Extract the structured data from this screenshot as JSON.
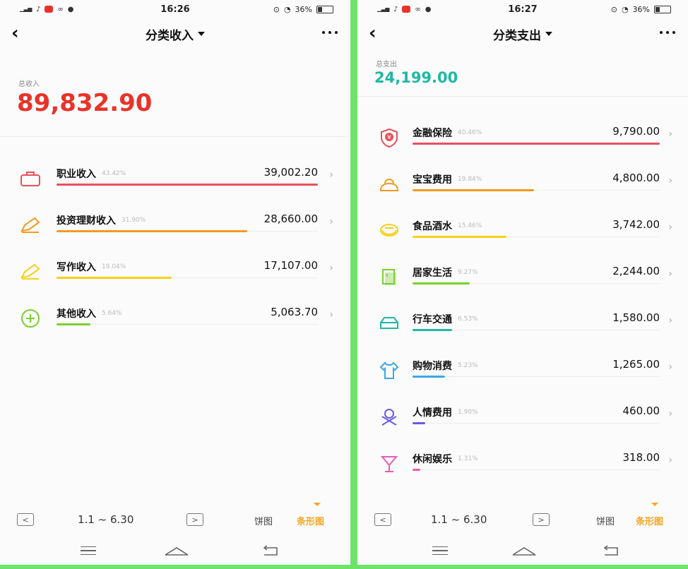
{
  "colors": {
    "income_total": "#e8332a",
    "expense_total": "#1db9a5",
    "active_view": "#f5a623",
    "frame": "#6ee36a"
  },
  "left": {
    "status": {
      "time": "16:26",
      "battery": "36%"
    },
    "title": "分类收入",
    "total_label": "总收入",
    "total_value": "89,832.90",
    "items": [
      {
        "name": "职业收入",
        "percent": "43.42%",
        "amount": "39,002.20",
        "icon": "briefcase-icon",
        "color": "#e8505a",
        "ratio": 1.0
      },
      {
        "name": "投资理财收入",
        "percent": "31.90%",
        "amount": "28,660.00",
        "icon": "pencil-icon",
        "color": "#f39a1e",
        "ratio": 0.73
      },
      {
        "name": "写作收入",
        "percent": "19.04%",
        "amount": "17,107.00",
        "icon": "pencil-icon",
        "color": "#f5d218",
        "ratio": 0.44
      },
      {
        "name": "其他收入",
        "percent": "5.64%",
        "amount": "5,063.70",
        "icon": "plus-circle-icon",
        "color": "#7ccf2e",
        "ratio": 0.13
      }
    ],
    "date_range": "1.1 ~ 6.30",
    "prev_label": "<",
    "next_label": ">",
    "view_pie": "饼图",
    "view_bar": "条形图"
  },
  "right": {
    "status": {
      "time": "16:27",
      "battery": "36%"
    },
    "title": "分类支出",
    "total_label": "总支出",
    "total_value": "24,199.00",
    "items": [
      {
        "name": "金融保险",
        "percent": "40.46%",
        "amount": "9,790.00",
        "icon": "shield-yen-icon",
        "color": "#e8505a",
        "ratio": 1.0
      },
      {
        "name": "宝宝费用",
        "percent": "19.84%",
        "amount": "4,800.00",
        "icon": "bag-icon",
        "color": "#f39a1e",
        "ratio": 0.49
      },
      {
        "name": "食品酒水",
        "percent": "15.46%",
        "amount": "3,742.00",
        "icon": "bowl-icon",
        "color": "#f5d218",
        "ratio": 0.38
      },
      {
        "name": "居家生活",
        "percent": "9.27%",
        "amount": "2,244.00",
        "icon": "book-icon",
        "color": "#7ccf2e",
        "ratio": 0.23
      },
      {
        "name": "行车交通",
        "percent": "6.53%",
        "amount": "1,580.00",
        "icon": "car-icon",
        "color": "#1db9a5",
        "ratio": 0.16
      },
      {
        "name": "购物消费",
        "percent": "5.23%",
        "amount": "1,265.00",
        "icon": "shirt-icon",
        "color": "#3aa8e8",
        "ratio": 0.13
      },
      {
        "name": "人情费用",
        "percent": "1.90%",
        "amount": "460.00",
        "icon": "person-icon",
        "color": "#6a5ae8",
        "ratio": 0.05
      },
      {
        "name": "休闲娱乐",
        "percent": "1.31%",
        "amount": "318.00",
        "icon": "cocktail-icon",
        "color": "#e85ab8",
        "ratio": 0.03
      }
    ],
    "date_range": "1.1 ~ 6.30",
    "prev_label": "<",
    "next_label": ">",
    "view_pie": "饼图",
    "view_bar": "条形图"
  }
}
